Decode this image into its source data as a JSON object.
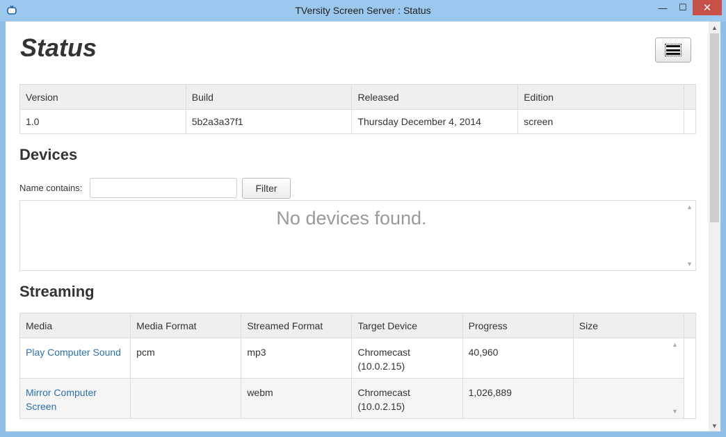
{
  "window": {
    "title": "TVersity Screen Server : Status",
    "min_glyph": "—",
    "max_glyph": "☐",
    "close_glyph": "✕"
  },
  "page": {
    "title": "Status"
  },
  "version_table": {
    "headers": [
      "Version",
      "Build",
      "Released",
      "Edition"
    ],
    "row": [
      "1.0",
      "5b2a3a37f1",
      "Thursday December 4, 2014",
      "screen"
    ]
  },
  "devices": {
    "heading": "Devices",
    "filter_label": "Name contains:",
    "filter_value": "",
    "filter_button": "Filter",
    "empty_message": "No devices found."
  },
  "streaming": {
    "heading": "Streaming",
    "headers": [
      "Media",
      "Media Format",
      "Streamed Format",
      "Target Device",
      "Progress",
      "Size"
    ],
    "rows": [
      {
        "media": "Play Computer Sound",
        "media_format": "pcm",
        "streamed_format": "mp3",
        "target_device": "Chromecast (10.0.2.15)",
        "progress": "40,960",
        "size": ""
      },
      {
        "media": "Mirror Computer Screen",
        "media_format": "",
        "streamed_format": "webm",
        "target_device": "Chromecast (10.0.2.15)",
        "progress": "1,026,889",
        "size": ""
      }
    ]
  },
  "icons": {
    "app": "tversity-app-icon",
    "menu": "hamburger-menu-icon",
    "scroll_up": "▲",
    "scroll_down": "▼"
  },
  "colors": {
    "titlebar": "#9cc8ee",
    "close_button": "#c7504a",
    "link": "#2a6fb0"
  }
}
